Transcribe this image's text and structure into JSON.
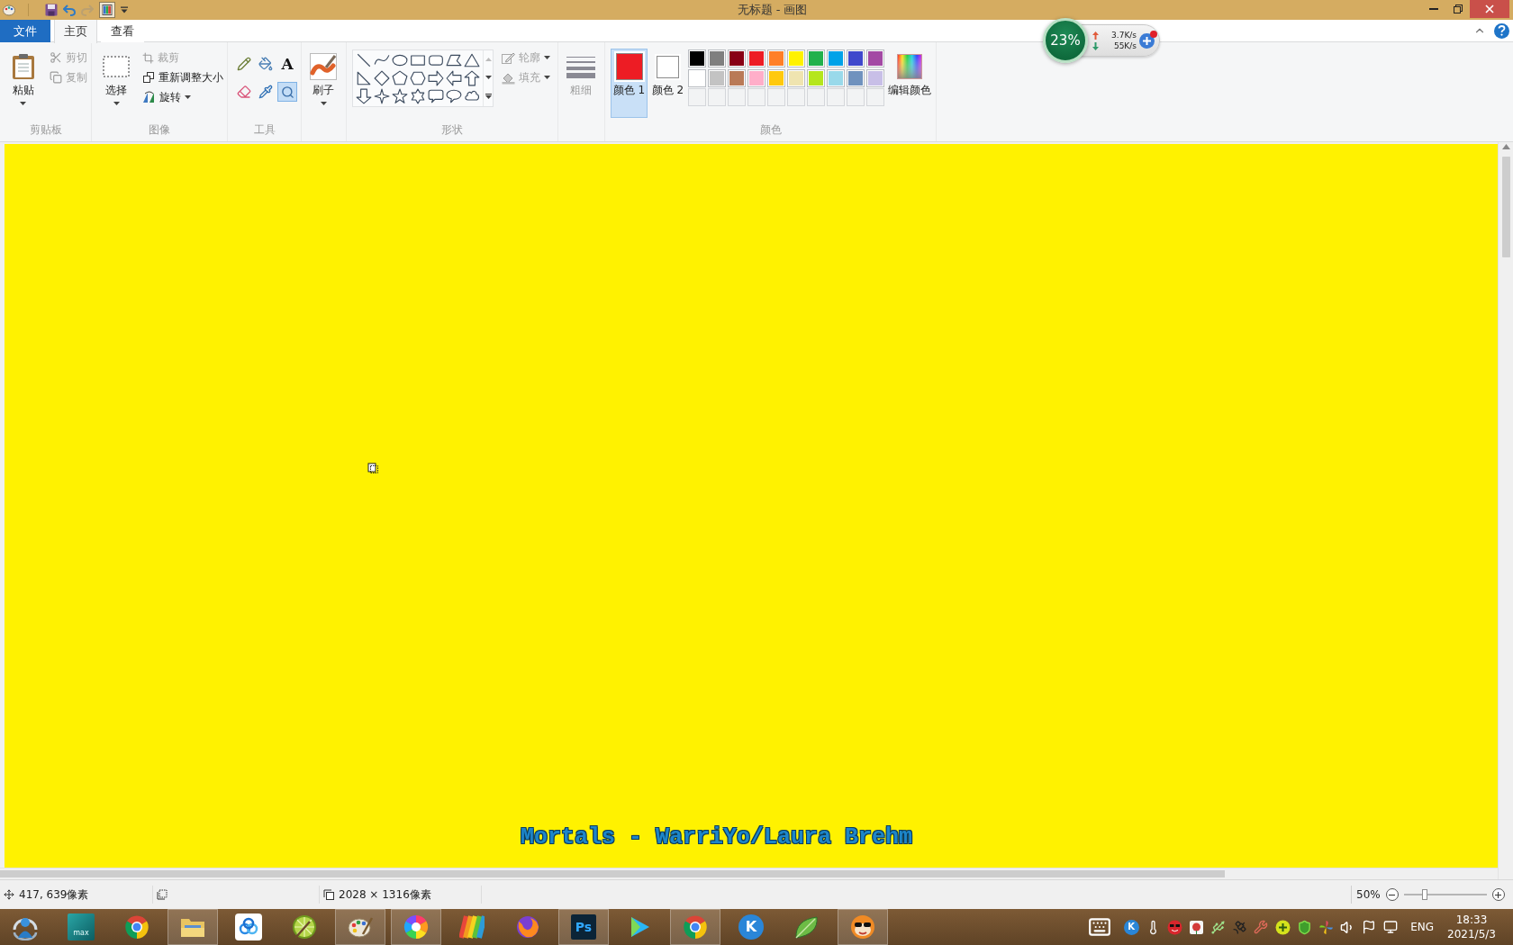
{
  "title_bar": {
    "quick_access": [
      {
        "kind": "app",
        "disabled": false
      },
      {
        "kind": "save",
        "disabled": false
      },
      {
        "kind": "undo",
        "disabled": false
      },
      {
        "kind": "redo",
        "disabled": true
      },
      {
        "kind": "properties",
        "disabled": false
      },
      {
        "kind": "customize",
        "disabled": false
      }
    ],
    "title": "无标题 - 画图"
  },
  "tabs": [
    {
      "label": "文件",
      "kind": "file",
      "selected": false
    },
    {
      "label": "主页",
      "kind": "tab",
      "selected": true
    },
    {
      "label": "查看",
      "kind": "tab",
      "selected": false
    }
  ],
  "ribbon": {
    "clipboard": {
      "label": "剪贴板",
      "paste": "粘贴",
      "actions": [
        {
          "label": "剪切",
          "kind": "cut",
          "disabled": true
        },
        {
          "label": "复制",
          "kind": "copy",
          "disabled": true
        }
      ]
    },
    "image": {
      "label": "图像",
      "select": "选择",
      "actions": [
        {
          "label": "裁剪",
          "kind": "crop",
          "disabled": true,
          "dropdown": false
        },
        {
          "label": "重新调整大小",
          "kind": "resize",
          "disabled": false,
          "dropdown": false
        },
        {
          "label": "旋转",
          "kind": "rotate",
          "disabled": false,
          "dropdown": true
        }
      ]
    },
    "tools": {
      "label": "工具",
      "items": [
        {
          "kind": "pencil",
          "selected": false
        },
        {
          "kind": "fill",
          "selected": false
        },
        {
          "kind": "text",
          "glyph": "A",
          "selected": false
        },
        {
          "kind": "eraser",
          "selected": false
        },
        {
          "kind": "picker",
          "selected": false
        },
        {
          "kind": "magnifier",
          "selected": true
        }
      ]
    },
    "brushes": {
      "button": "刷子"
    },
    "shapes": {
      "label": "形状",
      "items": [
        {
          "kind": "line"
        },
        {
          "kind": "curve"
        },
        {
          "kind": "oval"
        },
        {
          "kind": "rectangle"
        },
        {
          "kind": "rounded_rectangle"
        },
        {
          "kind": "polygon"
        },
        {
          "kind": "triangle"
        },
        {
          "kind": "right_triangle"
        },
        {
          "kind": "diamond"
        },
        {
          "kind": "pentagon"
        },
        {
          "kind": "hexagon"
        },
        {
          "kind": "arrow_right"
        },
        {
          "kind": "arrow_left"
        },
        {
          "kind": "arrow_up"
        },
        {
          "kind": "arrow_down"
        },
        {
          "kind": "star_4"
        },
        {
          "kind": "star_5"
        },
        {
          "kind": "star_6"
        },
        {
          "kind": "callout_rounded"
        },
        {
          "kind": "callout_oval"
        },
        {
          "kind": "callout_cloud"
        }
      ],
      "outline": {
        "label": "轮廓",
        "disabled": true
      },
      "fill": {
        "label": "填充",
        "disabled": true
      }
    },
    "size": {
      "button": "粗细",
      "disabled": true
    },
    "colors": {
      "label": "颜色",
      "slots": [
        {
          "label": "颜色 1",
          "color": "#ed1c24",
          "selected": true
        },
        {
          "label": "颜色 2",
          "color": "#ffffff",
          "selected": false
        }
      ],
      "palette": [
        {
          "kind": "swatch",
          "color": "#000000"
        },
        {
          "kind": "swatch",
          "color": "#7f7f7f"
        },
        {
          "kind": "swatch",
          "color": "#880015"
        },
        {
          "kind": "swatch",
          "color": "#ed1c24"
        },
        {
          "kind": "swatch",
          "color": "#ff7f27"
        },
        {
          "kind": "swatch",
          "color": "#fff200"
        },
        {
          "kind": "swatch",
          "color": "#22b14c"
        },
        {
          "kind": "swatch",
          "color": "#00a2e8"
        },
        {
          "kind": "swatch",
          "color": "#3f48cc"
        },
        {
          "kind": "swatch",
          "color": "#a349a4"
        },
        {
          "kind": "swatch",
          "color": "#ffffff"
        },
        {
          "kind": "swatch",
          "color": "#c3c3c3"
        },
        {
          "kind": "swatch",
          "color": "#b97a57"
        },
        {
          "kind": "swatch",
          "color": "#ffaec9"
        },
        {
          "kind": "swatch",
          "color": "#ffc90e"
        },
        {
          "kind": "swatch",
          "color": "#efe4b0"
        },
        {
          "kind": "swatch",
          "color": "#b5e61d"
        },
        {
          "kind": "swatch",
          "color": "#99d9ea"
        },
        {
          "kind": "swatch",
          "color": "#7092be"
        },
        {
          "kind": "swatch",
          "color": "#c8bfe7"
        },
        {
          "kind": "empty"
        },
        {
          "kind": "empty"
        },
        {
          "kind": "empty"
        },
        {
          "kind": "empty"
        },
        {
          "kind": "empty"
        },
        {
          "kind": "empty"
        },
        {
          "kind": "empty"
        },
        {
          "kind": "empty"
        },
        {
          "kind": "empty"
        },
        {
          "kind": "empty"
        }
      ],
      "edit": "编辑颜色"
    }
  },
  "network_widget": {
    "memory": "23%",
    "upload": "3.7K/s",
    "download": "55K/s",
    "notification": true
  },
  "canvas": {
    "caption": "Mortals - WarriYo/Laura Brehm"
  },
  "status_bar": {
    "cursor_position": "417, 639像素",
    "image_size": "2028 × 1316像素",
    "zoom": "50%",
    "zoom_slider": {
      "level": 0.25
    }
  },
  "taskbar": {
    "apps": [
      {
        "kind": "sync",
        "open": false
      },
      {
        "kind": "cube",
        "label": "max",
        "open": false
      },
      {
        "kind": "tricolor",
        "open": false
      },
      {
        "kind": "folder",
        "open": true
      },
      {
        "kind": "rings",
        "open": false
      },
      {
        "kind": "lime",
        "open": false
      },
      {
        "kind": "palette",
        "open": true
      },
      {
        "kind": "swirl",
        "open": true
      },
      {
        "kind": "ball",
        "open": false
      },
      {
        "kind": "globe",
        "open": false
      },
      {
        "kind": "ps",
        "label": "Ps",
        "open": true
      },
      {
        "kind": "play",
        "open": false
      },
      {
        "kind": "tricolor",
        "open": true
      },
      {
        "kind": "letter",
        "label": "K",
        "open": false
      },
      {
        "kind": "leaf",
        "open": false
      },
      {
        "kind": "mascot",
        "open": true
      }
    ],
    "tray": [
      {
        "kind": "keyboard"
      },
      {
        "kind": "letter",
        "label": "K"
      },
      {
        "kind": "thermometer"
      },
      {
        "kind": "face"
      },
      {
        "kind": "rose"
      },
      {
        "kind": "usb"
      },
      {
        "kind": "satellite"
      },
      {
        "kind": "wrench"
      },
      {
        "kind": "plus"
      },
      {
        "kind": "shield"
      },
      {
        "kind": "pinwheel"
      },
      {
        "kind": "speaker"
      },
      {
        "kind": "flag"
      },
      {
        "kind": "network"
      }
    ],
    "language": "ENG",
    "time": "18:33",
    "date": "2021/5/3"
  }
}
